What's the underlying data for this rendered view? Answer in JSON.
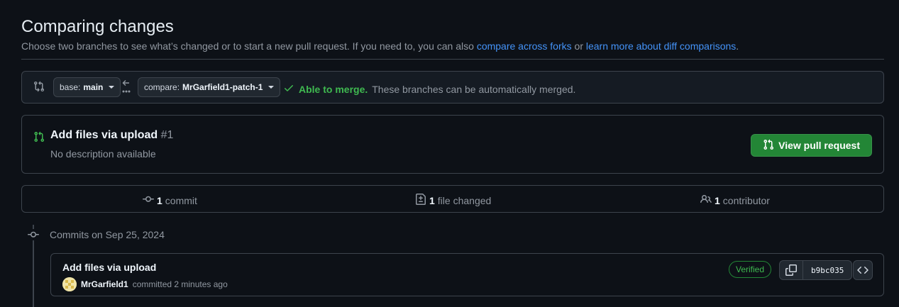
{
  "header": {
    "title": "Comparing changes",
    "subtitle_text": "Choose two branches to see what’s changed or to start a new pull request. If you need to, you can also ",
    "link_forks": "compare across forks",
    "subtitle_or": " or ",
    "link_learn": "learn more about diff comparisons",
    "subtitle_end": "."
  },
  "range": {
    "base_prefix": "base:",
    "base_branch": "main",
    "compare_prefix": "compare:",
    "compare_branch": "MrGarfield1-patch-1",
    "merge_ok": "Able to merge.",
    "merge_desc": "These branches can be automatically merged."
  },
  "pr": {
    "title": "Add files via upload",
    "number": "#1",
    "description": "No description available",
    "view_button": "View pull request"
  },
  "stats": {
    "commits_count": "1",
    "commits_label": "commit",
    "files_count": "1",
    "files_label": "file changed",
    "contributors_count": "1",
    "contributors_label": "contributor"
  },
  "timeline": {
    "date_label": "Commits on Sep 25, 2024"
  },
  "commit": {
    "title": "Add files via upload",
    "author": "MrGarfield1",
    "action": "committed 2 minutes ago",
    "verified": "Verified",
    "sha": "b9bc035"
  },
  "colors": {
    "background": "#0d1117",
    "accent_link": "#4493f8",
    "success": "#3fb950",
    "primary_button": "#238636"
  },
  "icons": [
    "git-compare-icon",
    "arrow-left-icon",
    "check-icon",
    "git-pull-request-icon",
    "git-commit-icon",
    "file-diff-icon",
    "people-icon",
    "copy-icon",
    "code-icon"
  ]
}
